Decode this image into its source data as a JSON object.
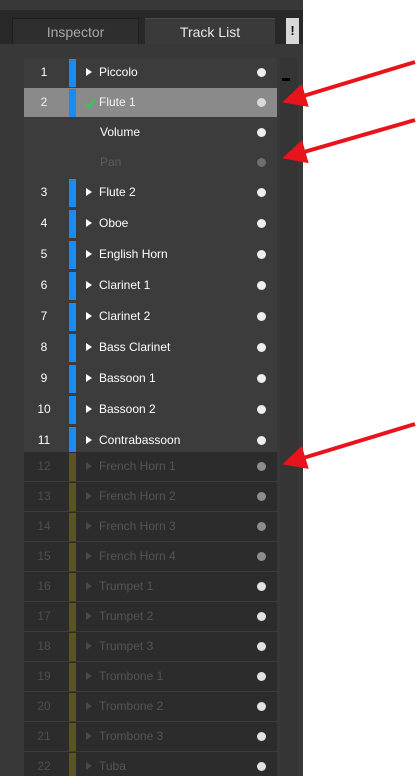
{
  "tabs": {
    "inspector": "Inspector",
    "track_list": "Track List",
    "warning": "!"
  },
  "tracks": [
    {
      "num": "1",
      "name": "Piccolo"
    },
    {
      "num": "2",
      "name": "Flute 1"
    },
    {
      "num": "",
      "name": "Volume"
    },
    {
      "num": "",
      "name": "Pan"
    },
    {
      "num": "3",
      "name": "Flute 2"
    },
    {
      "num": "4",
      "name": "Oboe"
    },
    {
      "num": "5",
      "name": "English Horn"
    },
    {
      "num": "6",
      "name": "Clarinet 1"
    },
    {
      "num": "7",
      "name": "Clarinet 2"
    },
    {
      "num": "8",
      "name": "Bass Clarinet"
    },
    {
      "num": "9",
      "name": "Bassoon 1"
    },
    {
      "num": "10",
      "name": "Bassoon 2"
    },
    {
      "num": "11",
      "name": "Contrabassoon"
    },
    {
      "num": "12",
      "name": "French Horn 1"
    },
    {
      "num": "13",
      "name": "French Horn 2"
    },
    {
      "num": "14",
      "name": "French Horn 3"
    },
    {
      "num": "15",
      "name": "French Horn 4"
    },
    {
      "num": "16",
      "name": "Trumpet 1"
    },
    {
      "num": "17",
      "name": "Trumpet 2"
    },
    {
      "num": "18",
      "name": "Trumpet 3"
    },
    {
      "num": "19",
      "name": "Trombone 1"
    },
    {
      "num": "20",
      "name": "Trombone 2"
    },
    {
      "num": "21",
      "name": "Trombone 3"
    },
    {
      "num": "22",
      "name": "Tuba"
    }
  ],
  "colors": {
    "panel_bg": "#383838",
    "selected_row": "#8a8a8a",
    "track_color_active": "#1a8cf0",
    "track_color_disabled": "#5a5324",
    "arrow": "#e8141c",
    "checkmark": "#2ecc40"
  }
}
